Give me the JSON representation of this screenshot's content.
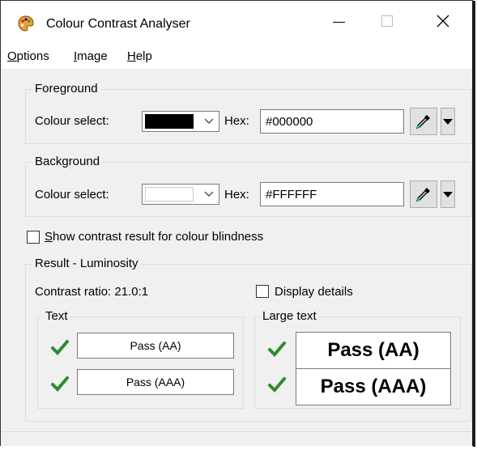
{
  "window": {
    "title": "Colour Contrast Analyser"
  },
  "menu": [
    {
      "mnemonic": "O",
      "rest": "ptions"
    },
    {
      "mnemonic": "I",
      "rest": "mage"
    },
    {
      "mnemonic": "H",
      "rest": "elp"
    }
  ],
  "foreground": {
    "label": "Foreground",
    "colour_select_label": "Colour select:",
    "swatch_color": "#000000",
    "hex_label": "Hex:",
    "hex_value": "#000000"
  },
  "background": {
    "label": "Background",
    "colour_select_label": "Colour select:",
    "swatch_color": "#FFFFFF",
    "hex_label": "Hex:",
    "hex_value": "#FFFFFF"
  },
  "colour_blindness": {
    "mnemonic": "S",
    "rest": "how contrast result for colour blindness"
  },
  "result": {
    "label": "Result - Luminosity",
    "contrast_ratio": "Contrast ratio: 21.0:1",
    "display_details": "Display details",
    "text": {
      "label": "Text",
      "aa": "Pass (AA)",
      "aaa": "Pass (AAA)"
    },
    "large_text": {
      "label": "Large text",
      "aa": "Pass (AA)",
      "aaa": "Pass (AAA)"
    }
  },
  "colors": {
    "pass_tick": "#2e8b2e",
    "accent_title_bg": "#ffffff"
  }
}
